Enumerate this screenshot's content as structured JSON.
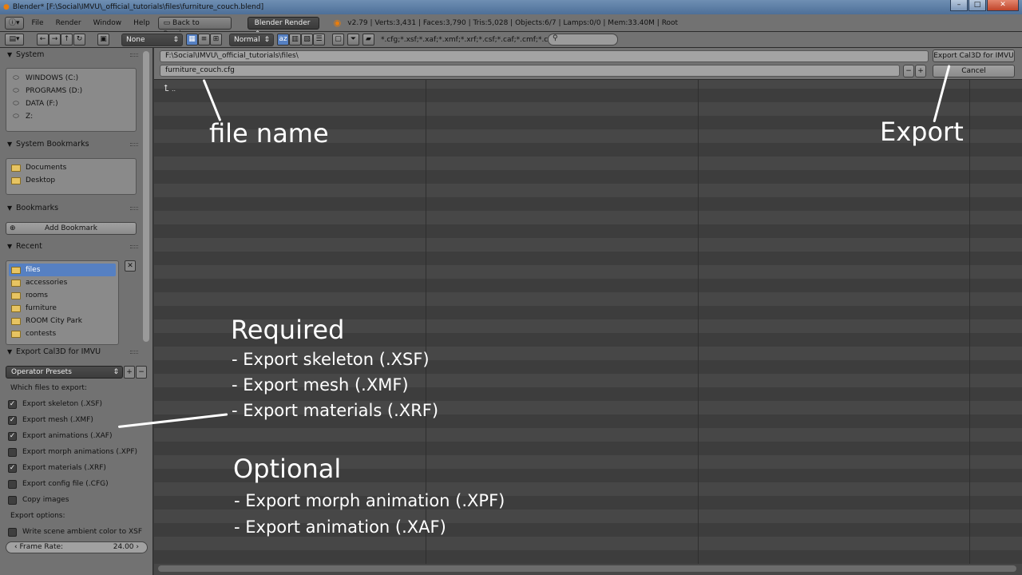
{
  "titlebar": {
    "title": "Blender* [F:\\Social\\IMVU\\_official_tutorials\\files\\furniture_couch.blend]"
  },
  "infobar": {
    "menus": [
      "File",
      "Render",
      "Window",
      "Help"
    ],
    "back_label": "Back to Previous",
    "engine": "Blender Render",
    "stats": "v2.79 | Verts:3,431 | Faces:3,790 | Tris:5,028 | Objects:6/7 | Lamps:0/0 | Mem:33.40M | Root"
  },
  "fbheader": {
    "recursion": "None",
    "display_size": "Normal",
    "filter": "*.cfg;*.xsf;*.xaf;*.xmf;*.xrf;*.csf;*.caf;*.cmf;*.crf"
  },
  "sidebar": {
    "system": {
      "title": "System",
      "items": [
        "WINDOWS (C:)",
        "PROGRAMS (D:)",
        "DATA (F:)",
        "Z:"
      ]
    },
    "system_bookmarks": {
      "title": "System Bookmarks",
      "items": [
        "Documents",
        "Desktop"
      ]
    },
    "bookmarks": {
      "title": "Bookmarks",
      "add_label": "Add Bookmark"
    },
    "recent": {
      "title": "Recent",
      "items": [
        "files",
        "accessories",
        "rooms",
        "furniture",
        "ROOM City Park",
        "contests"
      ]
    },
    "export": {
      "title": "Export Cal3D for IMVU",
      "preset": "Operator Presets",
      "which_label": "Which files to export:",
      "options_label": "Export options:",
      "checks": [
        {
          "label": "Export skeleton (.XSF)",
          "checked": true
        },
        {
          "label": "Export mesh (.XMF)",
          "checked": true
        },
        {
          "label": "Export animations (.XAF)",
          "checked": true
        },
        {
          "label": "Export morph animations (.XPF)",
          "checked": false
        },
        {
          "label": "Export materials (.XRF)",
          "checked": true
        },
        {
          "label": "Export config file (.CFG)",
          "checked": false
        },
        {
          "label": "Copy images",
          "checked": false
        }
      ],
      "ambient_label": "Write scene ambient color to XSF",
      "ambient_checked": false,
      "frame_rate_label": "Frame Rate:",
      "frame_rate_value": "24.00"
    }
  },
  "main": {
    "directory": "F:\\Social\\IMVU\\_official_tutorials\\files\\",
    "filename": "furniture_couch.cfg",
    "export_button": "Export Cal3D for IMVU",
    "cancel_button": "Cancel",
    "parent_dir": ".."
  },
  "overlay": {
    "file_name": "file name",
    "export": "Export",
    "required_title": "Required",
    "required_items": [
      "- Export skeleton (.XSF)",
      "- Export mesh (.XMF)",
      "- Export materials (.XRF)"
    ],
    "optional_title": "Optional",
    "optional_items": [
      "- Export morph animation (.XPF)",
      "- Export animation (.XAF)"
    ]
  }
}
